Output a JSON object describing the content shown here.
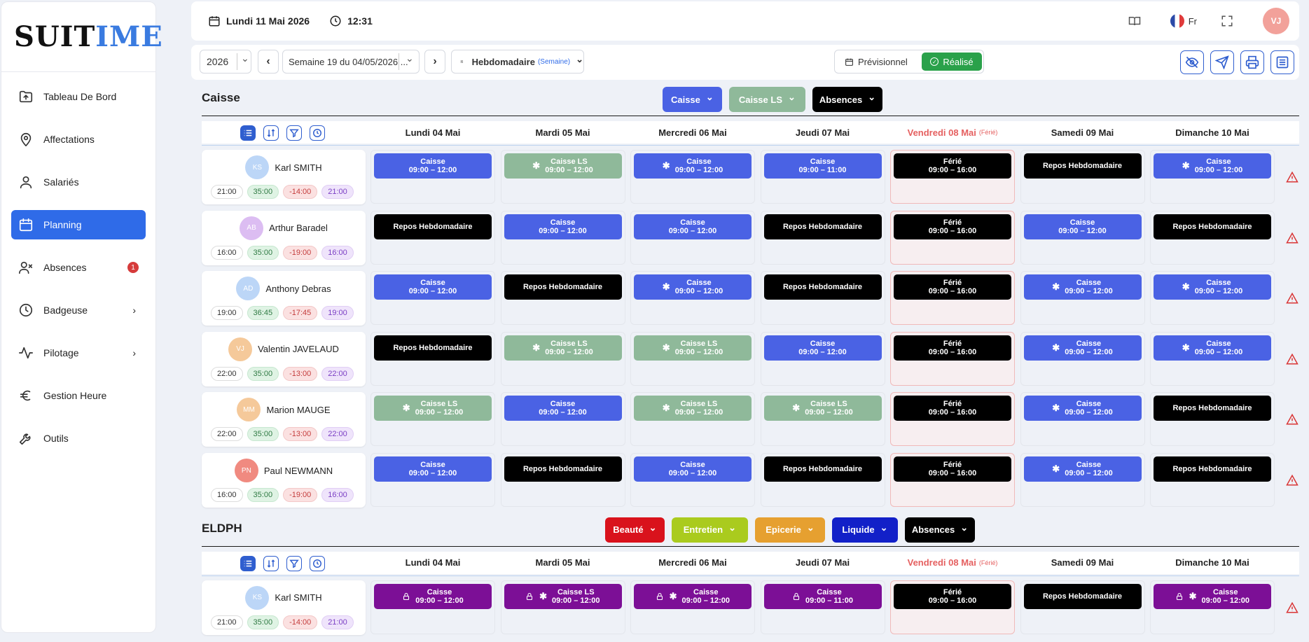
{
  "app": {
    "logo_a": "SUIT",
    "logo_i": "I",
    "logo_b": "ME"
  },
  "sidebar": {
    "items": [
      {
        "label": "Tableau De Bord",
        "icon": "upload-folder-icon"
      },
      {
        "label": "Affectations",
        "icon": "location-pin-icon"
      },
      {
        "label": "Salariés",
        "icon": "user-icon"
      },
      {
        "label": "Planning",
        "icon": "calendar-icon",
        "active": true
      },
      {
        "label": "Absences",
        "icon": "user-x-icon",
        "badge": "1"
      },
      {
        "label": "Badgeuse",
        "icon": "clock-icon",
        "chevron": true
      },
      {
        "label": "Pilotage",
        "icon": "activity-icon",
        "chevron": true
      },
      {
        "label": "Gestion Heure",
        "icon": "euro-icon"
      },
      {
        "label": "Outils",
        "icon": "wrench-icon"
      }
    ]
  },
  "topbar": {
    "date": "Lundi 11 Mai 2026",
    "time": "12:31",
    "lang": "Fr",
    "avatar": "VJ"
  },
  "toolbar": {
    "year": "2026",
    "week": "Semaine 19 du 04/05/2026 ...",
    "view": "Hebdomadaire",
    "view_sub": "(Semaine)",
    "previsionnel": "Prévisionnel",
    "realise": "Réalisé"
  },
  "days": [
    {
      "label": "Lundi 04 Mai"
    },
    {
      "label": "Mardi 05 Mai"
    },
    {
      "label": "Mercredi 06 Mai"
    },
    {
      "label": "Jeudi 07 Mai"
    },
    {
      "label": "Vendredi 08 Mai",
      "note": "(Férié)",
      "ferie": true
    },
    {
      "label": "Samedi 09 Mai"
    },
    {
      "label": "Dimanche 10 Mai"
    }
  ],
  "sections": [
    {
      "title": "Caisse",
      "filters": [
        {
          "label": "Caisse",
          "color": "#4a62e4"
        },
        {
          "label": "Caisse LS",
          "color": "#8fb99a"
        },
        {
          "label": "Absences",
          "color": "#000000"
        }
      ],
      "employees": [
        {
          "initials": "KS",
          "avcolor": "#bcd6f7",
          "name": "Karl SMITH",
          "pills": [
            "21:00",
            "35:00",
            "-14:00",
            "21:00"
          ],
          "shifts": [
            [
              "c",
              "Caisse",
              "09:00 – 12:00",
              0
            ],
            [
              "l",
              "Caisse LS",
              "09:00 – 12:00",
              1
            ],
            [
              "c",
              "Caisse",
              "09:00 – 12:00",
              1
            ],
            [
              "c",
              "Caisse",
              "09:00 – 11:00",
              0
            ],
            [
              "f",
              "Férié",
              "09:00 – 16:00",
              0
            ],
            [
              "r",
              "Repos Hebdomadaire",
              "",
              0
            ],
            [
              "c",
              "Caisse",
              "09:00 – 12:00",
              1
            ]
          ]
        },
        {
          "initials": "AB",
          "avcolor": "#dcbdf2",
          "name": "Arthur Baradel",
          "pills": [
            "16:00",
            "35:00",
            "-19:00",
            "16:00"
          ],
          "shifts": [
            [
              "r",
              "Repos Hebdomadaire",
              "",
              0
            ],
            [
              "c",
              "Caisse",
              "09:00 – 12:00",
              0
            ],
            [
              "c",
              "Caisse",
              "09:00 – 12:00",
              0
            ],
            [
              "r",
              "Repos Hebdomadaire",
              "",
              0
            ],
            [
              "f",
              "Férié",
              "09:00 – 16:00",
              0
            ],
            [
              "c",
              "Caisse",
              "09:00 – 12:00",
              0
            ],
            [
              "r",
              "Repos Hebdomadaire",
              "",
              0
            ]
          ]
        },
        {
          "initials": "AD",
          "avcolor": "#bcd6f7",
          "name": "Anthony Debras",
          "pills": [
            "19:00",
            "36:45",
            "-17:45",
            "19:00"
          ],
          "shifts": [
            [
              "c",
              "Caisse",
              "09:00 – 12:00",
              0
            ],
            [
              "r",
              "Repos Hebdomadaire",
              "",
              0
            ],
            [
              "c",
              "Caisse",
              "09:00 – 12:00",
              1
            ],
            [
              "r",
              "Repos Hebdomadaire",
              "",
              0
            ],
            [
              "f",
              "Férié",
              "09:00 – 16:00",
              0
            ],
            [
              "c",
              "Caisse",
              "09:00 – 12:00",
              1
            ],
            [
              "c",
              "Caisse",
              "09:00 – 12:00",
              1
            ]
          ]
        },
        {
          "initials": "VJ",
          "avcolor": "#f5c99a",
          "name": "Valentin JAVELAUD",
          "pills": [
            "22:00",
            "35:00",
            "-13:00",
            "22:00"
          ],
          "shifts": [
            [
              "r",
              "Repos Hebdomadaire",
              "",
              0
            ],
            [
              "l",
              "Caisse LS",
              "09:00 – 12:00",
              1
            ],
            [
              "l",
              "Caisse LS",
              "09:00 – 12:00",
              1
            ],
            [
              "c",
              "Caisse",
              "09:00 – 12:00",
              0
            ],
            [
              "f",
              "Férié",
              "09:00 – 16:00",
              0
            ],
            [
              "c",
              "Caisse",
              "09:00 – 12:00",
              1
            ],
            [
              "c",
              "Caisse",
              "09:00 – 12:00",
              1
            ]
          ]
        },
        {
          "initials": "MM",
          "avcolor": "#f5c99a",
          "name": "Marion MAUGE",
          "pills": [
            "22:00",
            "35:00",
            "-13:00",
            "22:00"
          ],
          "shifts": [
            [
              "l",
              "Caisse LS",
              "09:00 – 12:00",
              1
            ],
            [
              "c",
              "Caisse",
              "09:00 – 12:00",
              0
            ],
            [
              "l",
              "Caisse LS",
              "09:00 – 12:00",
              1
            ],
            [
              "l",
              "Caisse LS",
              "09:00 – 12:00",
              1
            ],
            [
              "f",
              "Férié",
              "09:00 – 16:00",
              0
            ],
            [
              "c",
              "Caisse",
              "09:00 – 12:00",
              1
            ],
            [
              "r",
              "Repos Hebdomadaire",
              "",
              0
            ]
          ]
        },
        {
          "initials": "PN",
          "avcolor": "#f08a80",
          "name": "Paul NEWMANN",
          "pills": [
            "16:00",
            "35:00",
            "-19:00",
            "16:00"
          ],
          "shifts": [
            [
              "c",
              "Caisse",
              "09:00 – 12:00",
              0
            ],
            [
              "r",
              "Repos Hebdomadaire",
              "",
              0
            ],
            [
              "c",
              "Caisse",
              "09:00 – 12:00",
              0
            ],
            [
              "r",
              "Repos Hebdomadaire",
              "",
              0
            ],
            [
              "f",
              "Férié",
              "09:00 – 16:00",
              0
            ],
            [
              "c",
              "Caisse",
              "09:00 – 12:00",
              1
            ],
            [
              "r",
              "Repos Hebdomadaire",
              "",
              0
            ]
          ]
        }
      ]
    },
    {
      "title": "ELDPH",
      "filters": [
        {
          "label": "Beauté",
          "color": "#d9121c"
        },
        {
          "label": "Entretien",
          "color": "#aacb1e"
        },
        {
          "label": "Epicerie",
          "color": "#e6a030"
        },
        {
          "label": "Liquide",
          "color": "#1220c8"
        },
        {
          "label": "Absences",
          "color": "#000000"
        }
      ],
      "employees": [
        {
          "initials": "KS",
          "avcolor": "#bcd6f7",
          "name": "Karl SMITH",
          "pills": [
            "21:00",
            "35:00",
            "-14:00",
            "21:00"
          ],
          "shifts": [
            [
              "p",
              "Caisse",
              "09:00 – 12:00",
              2
            ],
            [
              "p",
              "Caisse LS",
              "09:00 – 12:00",
              3
            ],
            [
              "p",
              "Caisse",
              "09:00 – 12:00",
              3
            ],
            [
              "p",
              "Caisse",
              "09:00 – 11:00",
              2
            ],
            [
              "f",
              "Férié",
              "09:00 – 16:00",
              0
            ],
            [
              "r",
              "Repos Hebdomadaire",
              "",
              0
            ],
            [
              "p",
              "Caisse",
              "09:00 – 12:00",
              3
            ]
          ]
        }
      ]
    }
  ],
  "colors": {
    "c": "#4a62e4",
    "l": "#8fb99a",
    "r": "#000000",
    "f": "#000000",
    "p": "#7c0f96",
    "accent": "#2f6be8"
  }
}
